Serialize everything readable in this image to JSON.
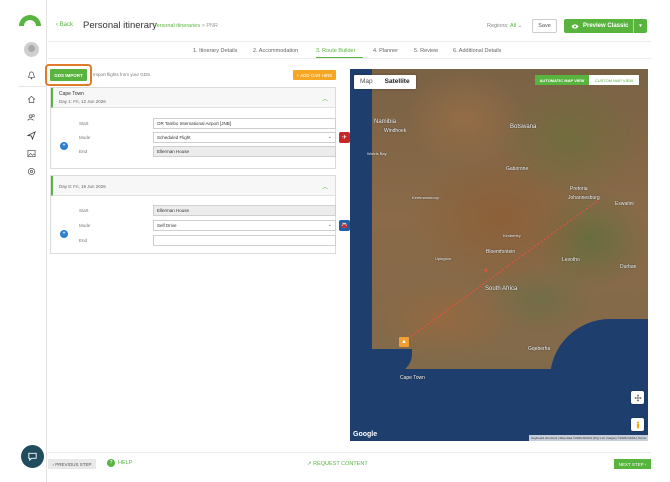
{
  "header": {
    "back_label": "‹ Back",
    "title": "Personal itinerary",
    "breadcrumb_parent": "Personal itineraries",
    "breadcrumb_sep": " > ",
    "breadcrumb_current": "PNR",
    "regions_label": "Regions:",
    "regions_value": "All",
    "save_label": "Save",
    "preview_label": "Preview Classic"
  },
  "steps": [
    {
      "label": "1. Itinerary Details",
      "active": false
    },
    {
      "label": "2. Accommodation",
      "active": false
    },
    {
      "label": "3. Route Builder",
      "active": true
    },
    {
      "label": "4. Planner",
      "active": false
    },
    {
      "label": "5. Review",
      "active": false
    },
    {
      "label": "6. Additional Details",
      "active": false
    }
  ],
  "toolbar": {
    "gds_import_label": "GDS IMPORT",
    "gds_note": "Import flights from your GDS.",
    "add_car_hire_label": "+ ADD CAR HIRE"
  },
  "segments": [
    {
      "place": "Cape Town",
      "day": "Day 1: Fri, 12 Jun 2026",
      "start_label": "Start",
      "start_value": "OR Tambo International Airport [JNB]",
      "mode_label": "Mode",
      "mode_value": "Scheduled Flight",
      "end_label": "End",
      "end_value": "Ellerman House"
    },
    {
      "place": "",
      "day": "Day 8: Fri, 19 Jun 2026",
      "start_label": "Start",
      "start_value": "Ellerman House",
      "mode_label": "Mode",
      "mode_value": "Self Drive",
      "end_label": "End",
      "end_value": ""
    }
  ],
  "map": {
    "type_map": "Map",
    "type_satellite": "Satellite",
    "auto_view_label": "AUTOMATIC MAP VIEW",
    "custom_view_label": "CUSTOM MAP VIEW",
    "labels": [
      {
        "text": "Namibia",
        "cls": "big"
      },
      {
        "text": "Windhoek",
        "cls": ""
      },
      {
        "text": "Botswana",
        "cls": "big"
      },
      {
        "text": "Gaborone",
        "cls": ""
      },
      {
        "text": "Pretoria",
        "cls": ""
      },
      {
        "text": "Johannesburg",
        "cls": ""
      },
      {
        "text": "Eswatini",
        "cls": ""
      },
      {
        "text": "Lesotho",
        "cls": ""
      },
      {
        "text": "Bloemfontein",
        "cls": ""
      },
      {
        "text": "South Africa",
        "cls": "big"
      },
      {
        "text": "Cape Town",
        "cls": ""
      },
      {
        "text": "Gqeberha",
        "cls": ""
      },
      {
        "text": "Durban",
        "cls": ""
      },
      {
        "text": "Walvis Bay",
        "cls": "small"
      },
      {
        "text": "Keetmanshoop",
        "cls": "small"
      },
      {
        "text": "Upington",
        "cls": "small"
      },
      {
        "text": "Kimberley",
        "cls": "small"
      }
    ],
    "google_label": "Google",
    "attribution": "Keyboard shortcuts | Map data ©2026 AfriGIS (Pty) Ltd, Imagery ©2026 NASA | Terms"
  },
  "footer": {
    "prev_label": "‹ PREVIOUS STEP",
    "help_label": "HELP",
    "request_label": "↗ REQUEST CONTENT",
    "next_label": "NEXT STEP ›"
  },
  "colors": {
    "brand_green": "#58b33f",
    "highlight_orange": "#e07b2a",
    "flight_red": "#c62828",
    "drive_blue": "#1f5fa8"
  }
}
